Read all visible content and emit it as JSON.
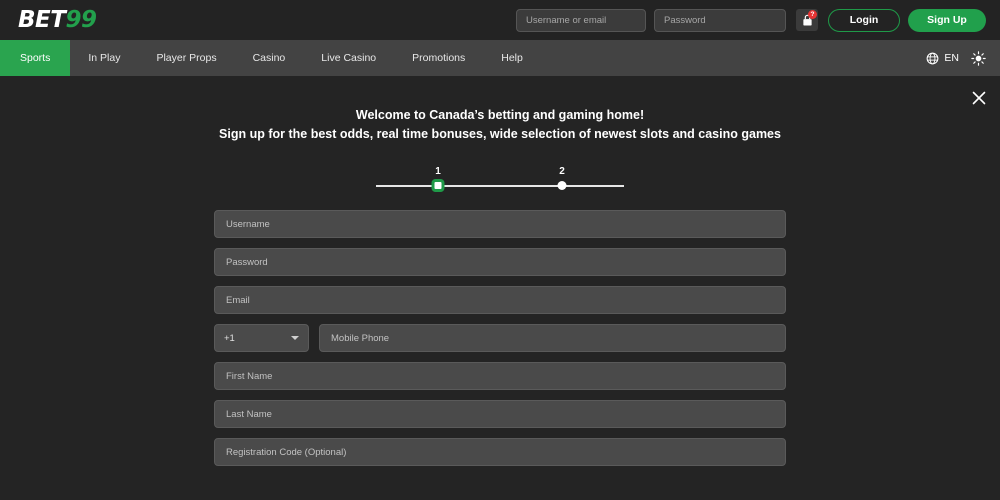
{
  "brand": {
    "logo_primary": "BET",
    "logo_accent": "99",
    "accent_color": "#21a04c",
    "background_color": "#242424",
    "nav_background": "#434343",
    "field_background": "#4a4a4a"
  },
  "header": {
    "username_placeholder": "Username or email",
    "username_value": "",
    "password_placeholder": "Password",
    "password_value": "",
    "lock_icon": "lock-icon",
    "lock_badge": "?",
    "login_label": "Login",
    "signup_label": "Sign Up"
  },
  "nav": {
    "items": [
      {
        "label": "Sports",
        "active": true
      },
      {
        "label": "In Play",
        "active": false
      },
      {
        "label": "Player Props",
        "active": false
      },
      {
        "label": "Casino",
        "active": false
      },
      {
        "label": "Live Casino",
        "active": false
      },
      {
        "label": "Promotions",
        "active": false
      },
      {
        "label": "Help",
        "active": false
      }
    ],
    "language_icon": "globe-icon",
    "language_label": "EN",
    "theme_icon": "sun-icon"
  },
  "modal": {
    "close_icon": "close-icon",
    "headline_line1": "Welcome to Canada’s betting and gaming home!",
    "headline_line2": "Sign up for the best odds, real time bonuses, wide selection of newest slots and casino games",
    "steps": [
      {
        "number": "1",
        "active": true
      },
      {
        "number": "2",
        "active": false
      }
    ],
    "form": {
      "username_placeholder": "Username",
      "username_value": "",
      "password_placeholder": "Password",
      "password_value": "",
      "email_placeholder": "Email",
      "email_value": "",
      "country_code_value": "+1",
      "mobile_placeholder": "Mobile Phone",
      "mobile_value": "",
      "first_name_placeholder": "First Name",
      "first_name_value": "",
      "last_name_placeholder": "Last Name",
      "last_name_value": "",
      "registration_code_placeholder": "Registration Code (Optional)",
      "registration_code_value": ""
    }
  }
}
